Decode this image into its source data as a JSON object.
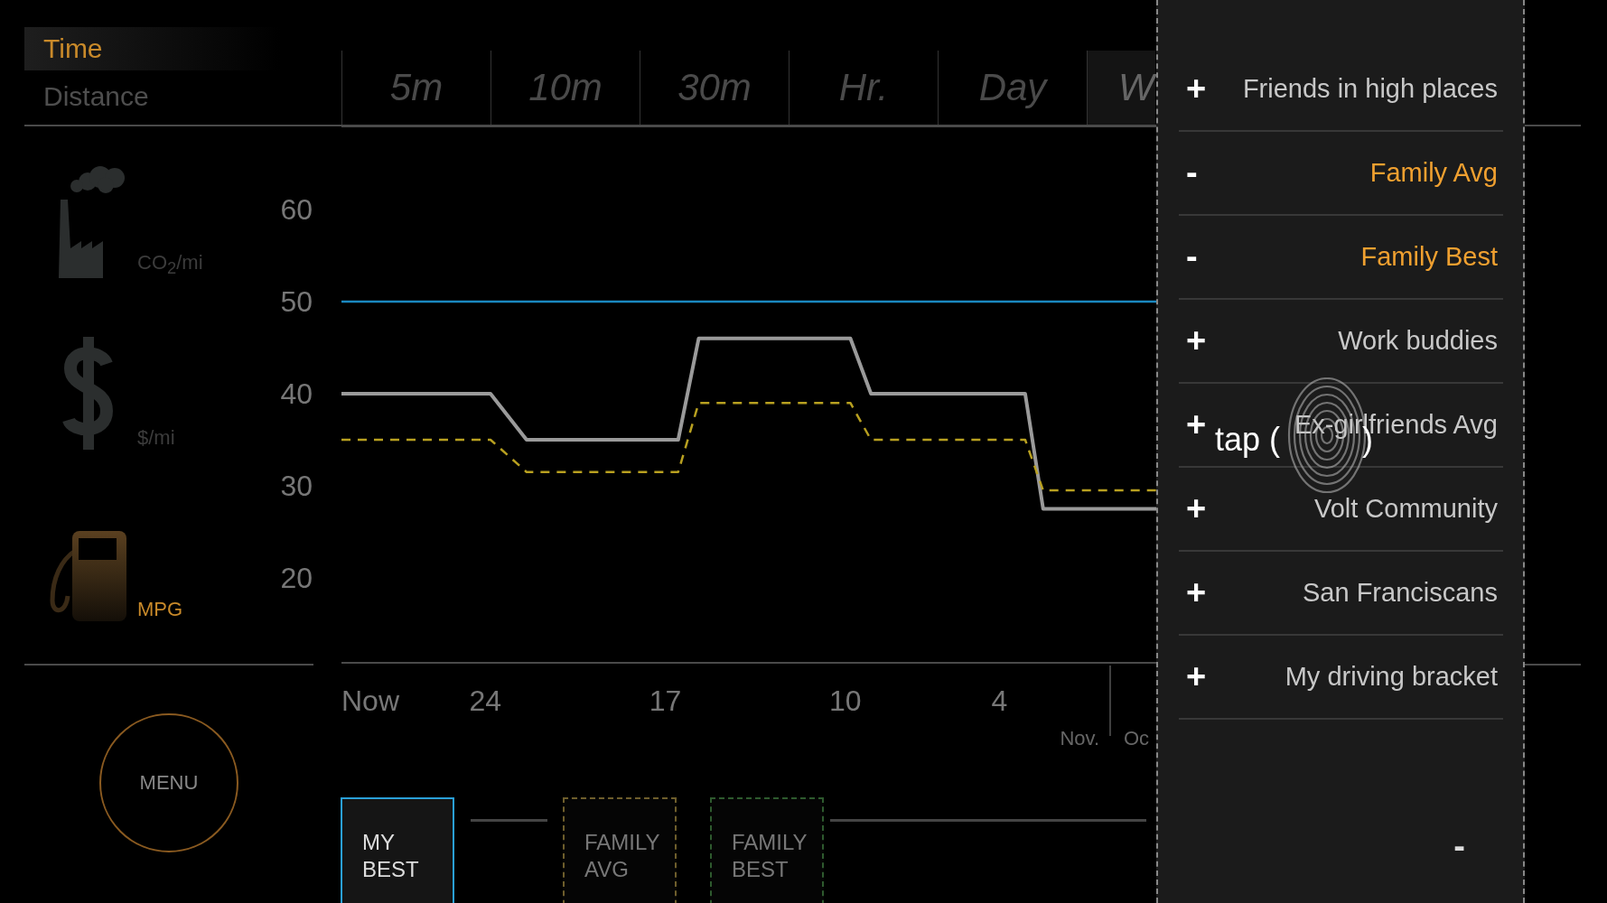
{
  "modes": [
    {
      "label": "Time",
      "selected": true
    },
    {
      "label": "Distance",
      "selected": false
    }
  ],
  "ranges": [
    {
      "label": "5m",
      "selected": false
    },
    {
      "label": "10m",
      "selected": false
    },
    {
      "label": "30m",
      "selected": false
    },
    {
      "label": "Hr.",
      "selected": false
    },
    {
      "label": "Day",
      "selected": false
    },
    {
      "label": "W",
      "selected": true
    }
  ],
  "metrics": [
    {
      "label": "CO$_{2}$/mi",
      "selected": false
    },
    {
      "label": "$/mi",
      "selected": false
    },
    {
      "label": "MPG",
      "selected": true
    }
  ],
  "chart": {
    "chart_data": {
      "type": "line",
      "x": [
        29.6,
        23.8,
        22.4,
        16.5,
        15.7,
        9.8,
        9.0,
        3.0,
        2.3,
        -2.1
      ],
      "xlim": [
        29.6,
        -2.1
      ],
      "ylim": [
        10.7,
        69
      ],
      "xticks": [
        {
          "value": 29.6,
          "label": "Now"
        },
        24,
        17,
        10,
        4
      ],
      "yticks": [
        60,
        50,
        40,
        30,
        20
      ],
      "series": [
        {
          "color": "#9a9a9a",
          "values": [
            40,
            40,
            35,
            35,
            46,
            46,
            40,
            40,
            27.5,
            27.5
          ]
        },
        {
          "color": "#b8a020",
          "line_style": "dashed",
          "values": [
            35,
            35,
            31.5,
            31.5,
            39,
            39,
            35,
            35,
            29.5,
            29.5
          ]
        },
        {
          "color": "#1a88c0",
          "values": [
            50,
            50,
            50,
            50,
            50,
            50,
            50,
            50,
            50,
            50
          ]
        }
      ]
    },
    "months": [
      "Nov.",
      "Oc"
    ]
  },
  "menu_button": "MENU",
  "legend": [
    {
      "label": "MY BEST",
      "selected": true,
      "color": "#2aa0d8"
    },
    {
      "label": "FAMILY AVG",
      "selected": false,
      "color": "#6e5e2c"
    },
    {
      "label": "FAMILY BEST",
      "selected": false,
      "color": "#2e5a2e"
    }
  ],
  "groups_panel": {
    "items": [
      {
        "sign": "+",
        "label": "Friends in high places",
        "selected": false
      },
      {
        "sign": "-",
        "label": "Family Avg",
        "selected": true
      },
      {
        "sign": "-",
        "label": "Family Best",
        "selected": true
      },
      {
        "sign": "+",
        "label": "Work buddies",
        "selected": false
      },
      {
        "sign": "+",
        "label": "Ex-girlfriends Avg",
        "selected": false
      },
      {
        "sign": "+",
        "label": "Volt Community",
        "selected": false
      },
      {
        "sign": "+",
        "label": "San Franciscans",
        "selected": false
      },
      {
        "sign": "+",
        "label": "My driving bracket",
        "selected": false
      }
    ],
    "collapse": "-"
  },
  "tap_hint": {
    "before": "tap (",
    "after": ")"
  }
}
